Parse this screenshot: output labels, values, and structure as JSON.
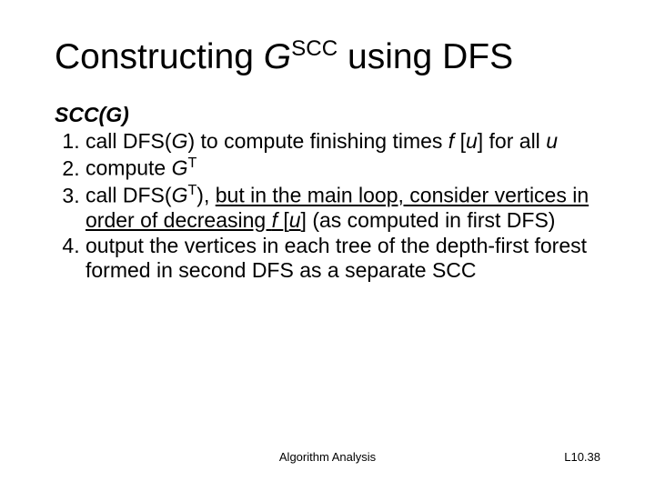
{
  "title": {
    "pre": "Constructing ",
    "gvar": "G",
    "gsup": "SCC",
    "post": " using DFS"
  },
  "alg_name": "SCC(G)",
  "steps": {
    "s1": {
      "a": "call DFS(",
      "g": "G",
      "b": ") to compute finishing times ",
      "f": "f ",
      "c": "[",
      "u": "u",
      "d": "] for all ",
      "u2": "u"
    },
    "s2": {
      "a": "compute ",
      "g": "G",
      "t": "T"
    },
    "s3": {
      "a": "call DFS(",
      "g": "G",
      "t": "T",
      "b": ")",
      "comma": ", ",
      "ul1": "but in the main loop, consider vertices in order of decreasing ",
      "f": "f ",
      "c": "[",
      "u": "u",
      "d": "]",
      "e": " (as computed in first DFS)"
    },
    "s4": {
      "a": "output the vertices in each tree of the depth-first forest formed in second DFS as a separate SCC"
    }
  },
  "footer_center": "Algorithm Analysis",
  "footer_right": "L10.38"
}
